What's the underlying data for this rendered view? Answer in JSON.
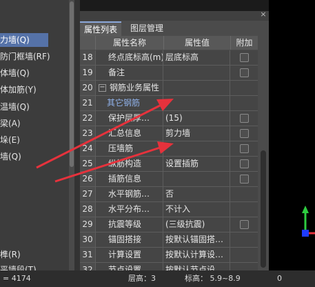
{
  "left_tree": {
    "items": [
      "力墙(Q)",
      "防门框墙(RF)",
      "体墙(Q)",
      "体加筋(Y)",
      "温墙(Q)",
      "梁(A)",
      "垛(E)",
      "墙(Q)",
      "榫(R)",
      "平墙段(T)"
    ]
  },
  "panel": {
    "close_glyph": "×",
    "tabs": [
      "属性列表",
      "图层管理"
    ],
    "headers": [
      "属性名称",
      "属性值",
      "附加"
    ],
    "rows": [
      {
        "num": "18",
        "name": "终点底标高(m)",
        "value": "层底标高",
        "check": true
      },
      {
        "num": "19",
        "name": "备注",
        "value": "",
        "check": true
      },
      {
        "num": "20",
        "name": "钢筋业务属性",
        "value": "",
        "check": false
      },
      {
        "num": "21",
        "name": "其它钢筋",
        "value": "",
        "check": false
      },
      {
        "num": "22",
        "name": "保护层厚…",
        "value": "(15)",
        "check": true
      },
      {
        "num": "23",
        "name": "汇总信息",
        "value": "剪力墙",
        "check": true
      },
      {
        "num": "24",
        "name": "压墙筋",
        "value": "",
        "check": true
      },
      {
        "num": "25",
        "name": "纵筋构造",
        "value": "设置插筋",
        "check": true
      },
      {
        "num": "26",
        "name": "插筋信息",
        "value": "",
        "check": true
      },
      {
        "num": "27",
        "name": "水平钢筋…",
        "value": "否",
        "check": false
      },
      {
        "num": "28",
        "name": "水平分布…",
        "value": "不计入",
        "check": false
      },
      {
        "num": "29",
        "name": "抗震等级",
        "value": "(三级抗震)",
        "check": true
      },
      {
        "num": "30",
        "name": "锚固搭接",
        "value": "按默认锚固搭…",
        "check": false
      },
      {
        "num": "31",
        "name": "计算设置",
        "value": "按默认计算设…",
        "check": false
      },
      {
        "num": "32",
        "name": "节点设置",
        "value": "按默认节点设…",
        "check": false
      }
    ]
  },
  "status_bar": {
    "coord": "= 4174",
    "floor_height": "层高：3",
    "elevation": "标高：  5.9~8.9",
    "value": "0"
  },
  "colors": {
    "selected": "#5572a8",
    "annotation_arrow": "#e6323c",
    "axis_y": "#2ecc40",
    "axis_z": "#1f3cff",
    "axis_x": "#e6323c"
  },
  "icons": [
    "close-icon",
    "collapse-minus-icon",
    "axis-gizmo-icon",
    "red-annotation-arrow"
  ]
}
